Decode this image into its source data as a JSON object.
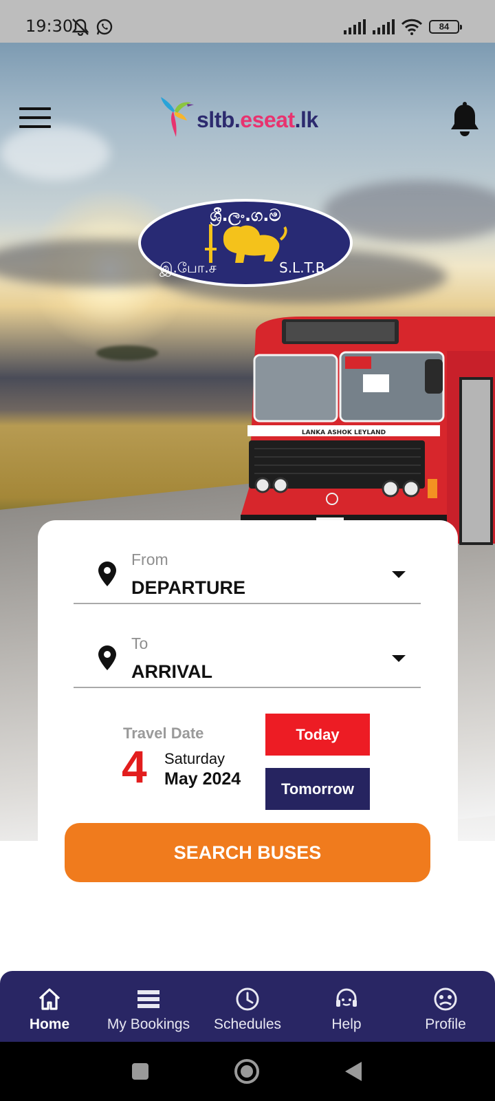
{
  "status_bar": {
    "time": "19:30",
    "battery": "84",
    "icons": [
      "mute-icon",
      "whatsapp-icon",
      "signal-icon",
      "signal-icon",
      "wifi-icon",
      "battery-icon"
    ]
  },
  "header": {
    "brand": {
      "part1": "sltb.",
      "part2": "eseat",
      "part3": ".lk"
    },
    "logo_text": {
      "top": "ශ්‍රී.ලං.ග.ම",
      "left": "இ.போ.ச",
      "right": "S.L.T.B"
    },
    "bus_text": "LANKA ASHOK LEYLAND"
  },
  "search": {
    "from_label": "From",
    "from_value": "DEPARTURE",
    "to_label": "To",
    "to_value": "ARRIVAL",
    "date_label": "Travel Date",
    "date_day": "4",
    "date_weekday": "Saturday",
    "date_month": "May 2024",
    "today_label": "Today",
    "tomorrow_label": "Tomorrow",
    "search_label": "SEARCH BUSES"
  },
  "nav": [
    {
      "label": "Home",
      "icon": "home-icon",
      "active": true
    },
    {
      "label": "My Bookings",
      "icon": "bookings-icon",
      "active": false
    },
    {
      "label": "Schedules",
      "icon": "clock-icon",
      "active": false
    },
    {
      "label": "Help",
      "icon": "support-icon",
      "active": false
    },
    {
      "label": "Profile",
      "icon": "profile-icon",
      "active": false
    }
  ],
  "colors": {
    "primary_red": "#ed1c24",
    "navy": "#292664",
    "orange": "#f07b1d"
  }
}
